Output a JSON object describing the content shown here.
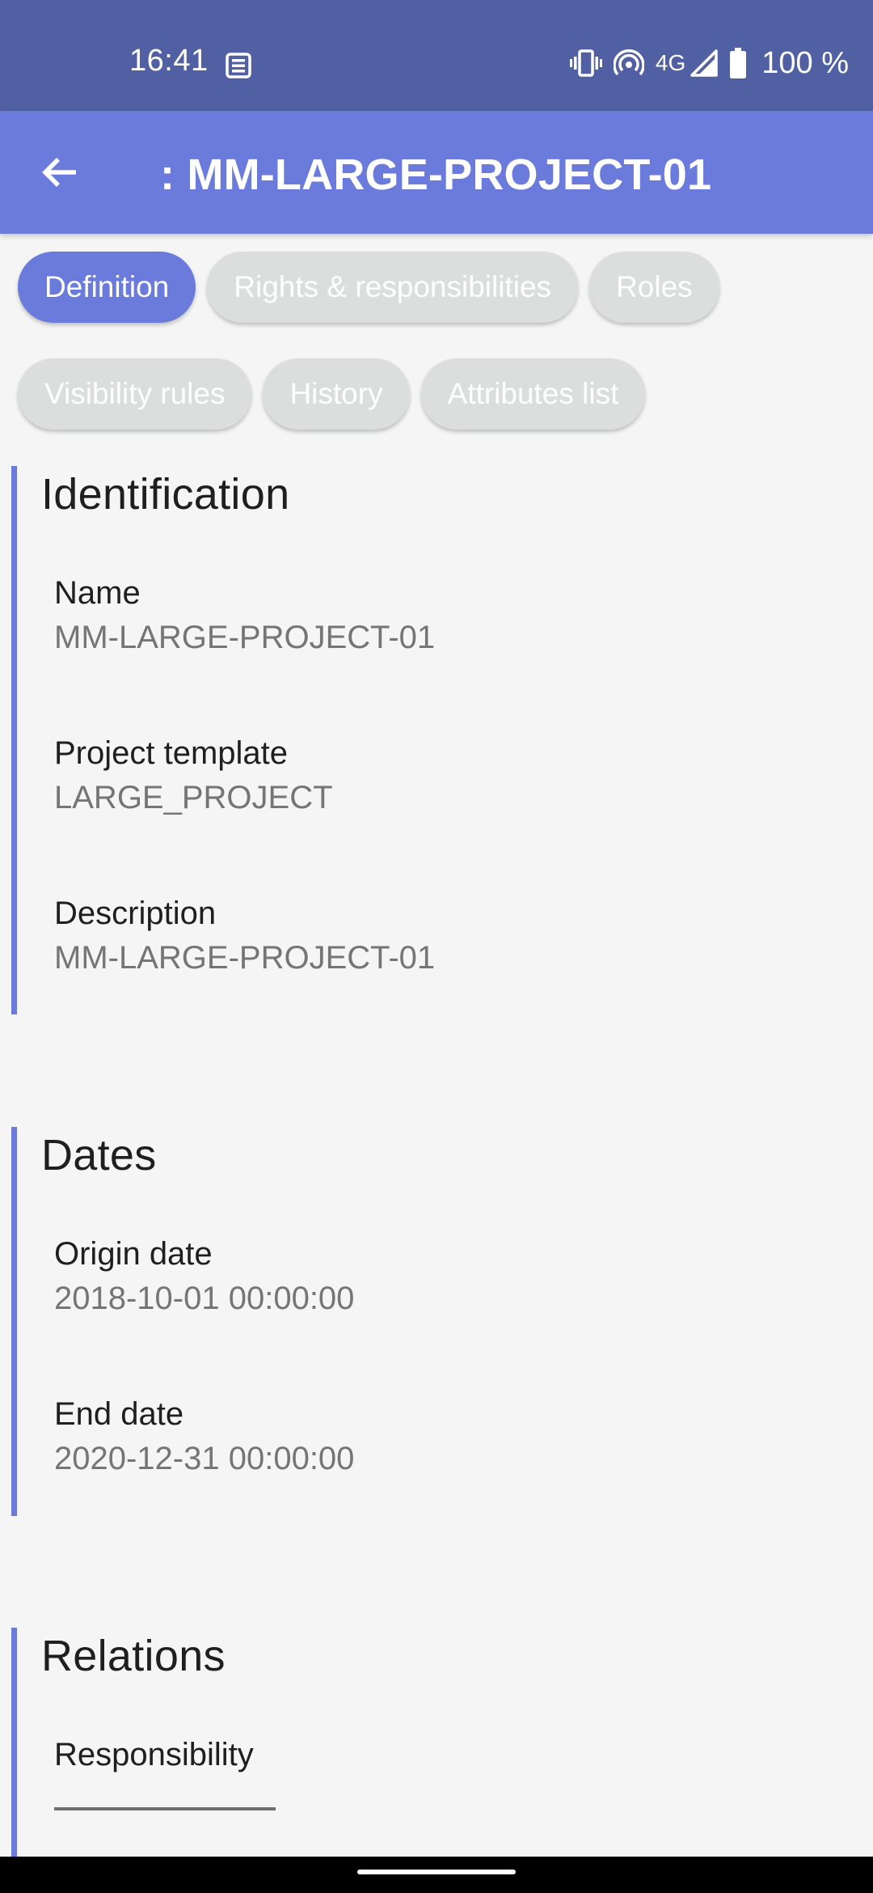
{
  "status_bar": {
    "time": "16:41",
    "network": "4G",
    "battery": "100 %",
    "icons": [
      "news-icon",
      "vibrate-icon",
      "hotspot-icon",
      "signal-icon",
      "battery-icon"
    ]
  },
  "app_bar": {
    "title": ": MM-LARGE-PROJECT-01",
    "back_icon": "arrow-left-icon"
  },
  "chips": [
    {
      "label": "Definition",
      "selected": true
    },
    {
      "label": "Rights & responsibilities",
      "selected": false
    },
    {
      "label": "Roles",
      "selected": false
    },
    {
      "label": "Visibility rules",
      "selected": false
    },
    {
      "label": "History",
      "selected": false
    },
    {
      "label": "Attributes list",
      "selected": false
    }
  ],
  "identification": {
    "title": "Identification",
    "fields": [
      {
        "label": "Name",
        "value": "MM-LARGE-PROJECT-01"
      },
      {
        "label": "Project template",
        "value": "LARGE_PROJECT"
      },
      {
        "label": "Description",
        "value": "MM-LARGE-PROJECT-01"
      }
    ]
  },
  "dates": {
    "title": "Dates",
    "fields": [
      {
        "label": "Origin date",
        "value": "2018-10-01 00:00:00"
      },
      {
        "label": "End date",
        "value": "2020-12-31 00:00:00"
      }
    ]
  },
  "relations": {
    "title": "Relations",
    "fields": [
      {
        "label": "Responsibility"
      }
    ]
  },
  "colors": {
    "status_bar": "#5160a3",
    "app_bar": "#6b7bdc",
    "accent": "#6b7bdc",
    "chip_inactive": "#dcdddd",
    "background": "#f4f5f4"
  }
}
